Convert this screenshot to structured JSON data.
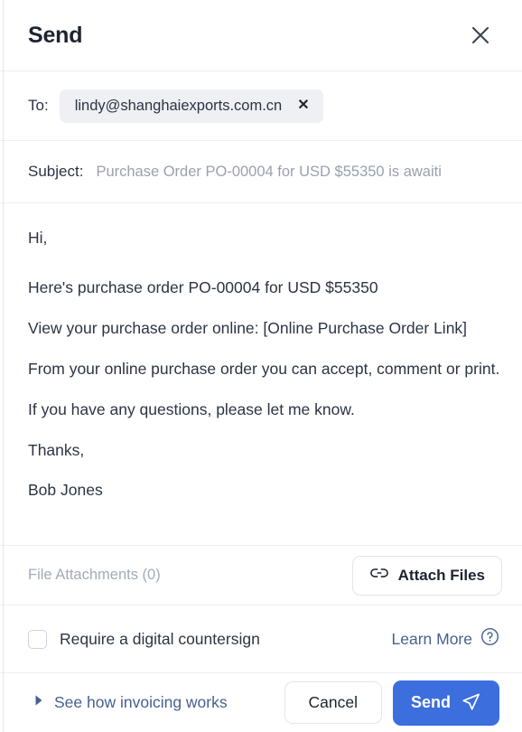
{
  "dialog": {
    "title": "Send",
    "close_icon": "close-x-icon"
  },
  "to": {
    "label": "To:",
    "recipients": [
      {
        "email": "lindy@shanghaiexports.com.cn",
        "remove_icon": "x-icon"
      }
    ]
  },
  "subject": {
    "label": "Subject:",
    "value": "Purchase Order PO-00004 for USD $55350 is awaiti"
  },
  "body": {
    "paragraphs": [
      "Hi,",
      "Here's purchase order PO-00004 for USD $55350",
      "View your purchase order online: [Online Purchase Order Link]",
      "From your online purchase order you can accept, comment or print.",
      "If you have any questions, please let me know.",
      "Thanks,",
      "Bob Jones"
    ]
  },
  "attachments": {
    "label": "File Attachments (0)",
    "count": 0,
    "button_label": "Attach Files",
    "button_icon": "link-chain-icon"
  },
  "countersign": {
    "label": "Require a digital countersign",
    "checked": false,
    "learn_more_label": "Learn More",
    "learn_more_icon": "question-circle-icon"
  },
  "footer": {
    "invoicing_link_label": "See how invoicing works",
    "invoicing_link_icon": "triangle-right-icon",
    "cancel_label": "Cancel",
    "send_label": "Send",
    "send_icon": "paper-plane-icon"
  },
  "colors": {
    "accent_blue": "#3c6ede",
    "link_blue": "#46618f",
    "text_primary": "#2c3444",
    "text_muted": "#a4abb6",
    "divider": "#eceef1",
    "chip_bg": "#eef0f4"
  }
}
